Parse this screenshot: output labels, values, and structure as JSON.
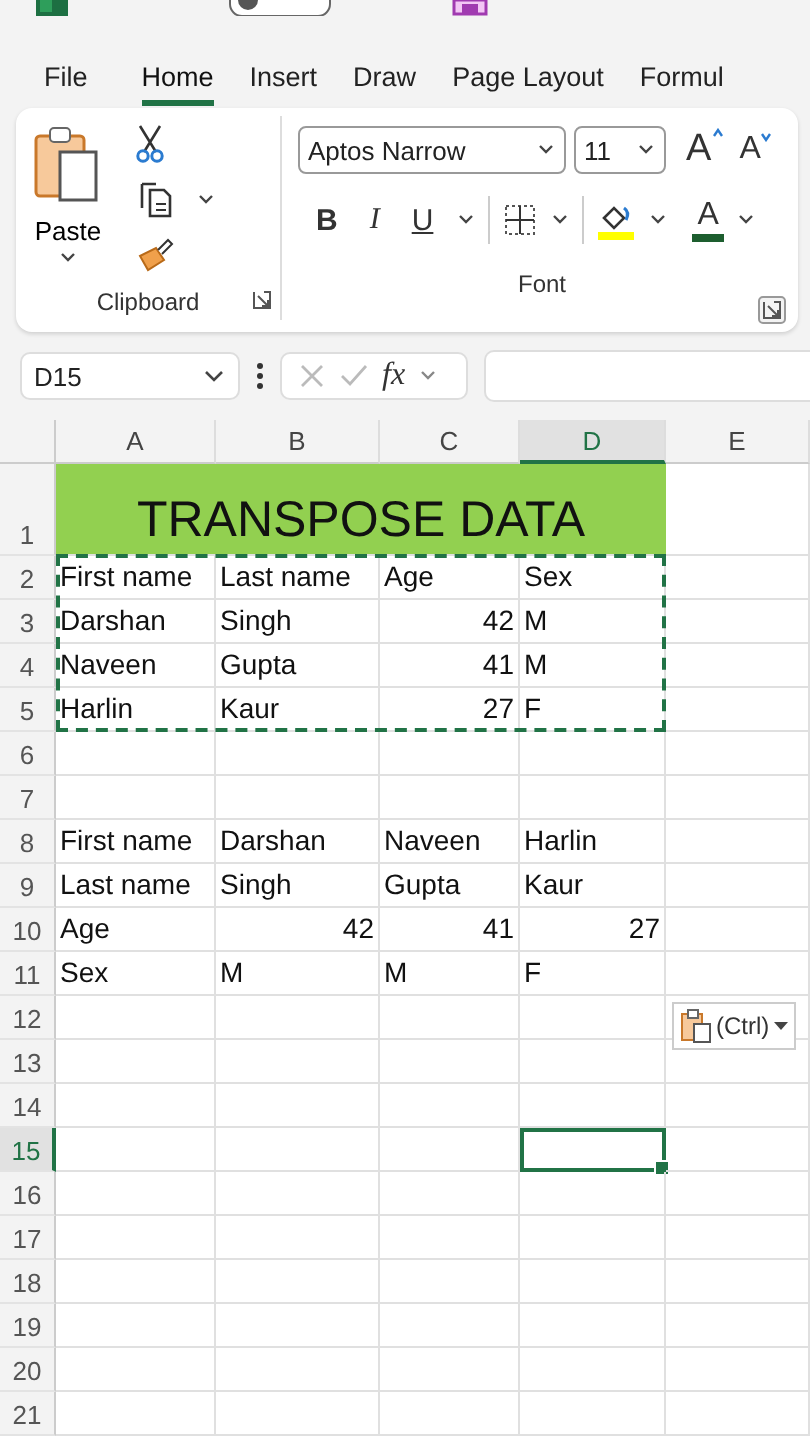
{
  "title_bar": {
    "autosave_on": false
  },
  "tabs": [
    {
      "label": "File",
      "selected": false
    },
    {
      "label": "Home",
      "selected": true
    },
    {
      "label": "Insert",
      "selected": false
    },
    {
      "label": "Draw",
      "selected": false
    },
    {
      "label": "Page Layout",
      "selected": false
    },
    {
      "label": "Formul",
      "selected": false
    }
  ],
  "ribbon": {
    "clipboard": {
      "paste_label": "Paste",
      "group_label": "Clipboard"
    },
    "font": {
      "font_name": "Aptos Narrow",
      "font_size": "11",
      "grow_label": "A",
      "shrink_label": "A",
      "bold": "B",
      "italic": "I",
      "underline": "U",
      "font_color_label": "A",
      "group_label": "Font"
    }
  },
  "formula_bar": {
    "name_box": "D15",
    "fx": "fx"
  },
  "sheet": {
    "columns": [
      {
        "label": "A",
        "selected": false
      },
      {
        "label": "B",
        "selected": false
      },
      {
        "label": "C",
        "selected": false
      },
      {
        "label": "D",
        "selected": true
      },
      {
        "label": "E",
        "selected": false
      }
    ],
    "title_cell": "TRANSPOSE DATA",
    "rows": [
      {
        "number": "1",
        "selected": false,
        "copied": false,
        "kind": "title"
      },
      {
        "number": "2",
        "selected": false,
        "copied": true,
        "kind": "cells",
        "cells": {
          "A": {
            "text": "First name",
            "kind": "text"
          },
          "B": {
            "text": "Last name",
            "kind": "text"
          },
          "C": {
            "text": "Age",
            "kind": "text"
          },
          "D": {
            "text": "Sex",
            "kind": "text"
          }
        }
      },
      {
        "number": "3",
        "selected": false,
        "copied": true,
        "kind": "cells",
        "cells": {
          "A": {
            "text": "Darshan",
            "kind": "text"
          },
          "B": {
            "text": "Singh",
            "kind": "text"
          },
          "C": {
            "text": "42",
            "kind": "number"
          },
          "D": {
            "text": "M",
            "kind": "text"
          }
        }
      },
      {
        "number": "4",
        "selected": false,
        "copied": true,
        "kind": "cells",
        "cells": {
          "A": {
            "text": "Naveen",
            "kind": "text"
          },
          "B": {
            "text": "Gupta",
            "kind": "text"
          },
          "C": {
            "text": "41",
            "kind": "number"
          },
          "D": {
            "text": "M",
            "kind": "text"
          }
        }
      },
      {
        "number": "5",
        "selected": false,
        "copied": true,
        "kind": "cells",
        "cells": {
          "A": {
            "text": "Harlin",
            "kind": "text"
          },
          "B": {
            "text": "Kaur",
            "kind": "text"
          },
          "C": {
            "text": "27",
            "kind": "number"
          },
          "D": {
            "text": "F",
            "kind": "text"
          }
        }
      },
      {
        "number": "6",
        "selected": false,
        "copied": false,
        "kind": "cells"
      },
      {
        "number": "7",
        "selected": false,
        "copied": false,
        "kind": "cells"
      },
      {
        "number": "8",
        "selected": false,
        "copied": false,
        "kind": "cells",
        "cells": {
          "A": {
            "text": "First name",
            "kind": "text"
          },
          "B": {
            "text": "Darshan",
            "kind": "text"
          },
          "C": {
            "text": "Naveen",
            "kind": "text"
          },
          "D": {
            "text": "Harlin",
            "kind": "text"
          }
        }
      },
      {
        "number": "9",
        "selected": false,
        "copied": false,
        "kind": "cells",
        "cells": {
          "A": {
            "text": "Last name",
            "kind": "text"
          },
          "B": {
            "text": "Singh",
            "kind": "text"
          },
          "C": {
            "text": "Gupta",
            "kind": "text"
          },
          "D": {
            "text": "Kaur",
            "kind": "text"
          }
        }
      },
      {
        "number": "10",
        "selected": false,
        "copied": false,
        "kind": "cells",
        "cells": {
          "A": {
            "text": "Age",
            "kind": "text"
          },
          "B": {
            "text": "42",
            "kind": "number"
          },
          "C": {
            "text": "41",
            "kind": "number"
          },
          "D": {
            "text": "27",
            "kind": "number"
          }
        }
      },
      {
        "number": "11",
        "selected": false,
        "copied": false,
        "kind": "cells",
        "cells": {
          "A": {
            "text": "Sex",
            "kind": "text"
          },
          "B": {
            "text": "M",
            "kind": "text"
          },
          "C": {
            "text": "M",
            "kind": "text"
          },
          "D": {
            "text": "F",
            "kind": "text"
          }
        }
      },
      {
        "number": "12",
        "selected": false,
        "copied": false,
        "kind": "cells"
      },
      {
        "number": "13",
        "selected": false,
        "copied": false,
        "kind": "cells"
      },
      {
        "number": "14",
        "selected": false,
        "copied": false,
        "kind": "cells"
      },
      {
        "number": "15",
        "selected": true,
        "copied": false,
        "kind": "cells",
        "cells": {
          "D": {
            "kind": "empty",
            "active": true
          }
        }
      },
      {
        "number": "16",
        "selected": false,
        "copied": false,
        "kind": "cells"
      },
      {
        "number": "17",
        "selected": false,
        "copied": false,
        "kind": "cells"
      },
      {
        "number": "18",
        "selected": false,
        "copied": false,
        "kind": "cells"
      },
      {
        "number": "19",
        "selected": false,
        "copied": false,
        "kind": "cells"
      },
      {
        "number": "20",
        "selected": false,
        "copied": false,
        "kind": "cells"
      },
      {
        "number": "21",
        "selected": false,
        "copied": false,
        "kind": "cells"
      }
    ]
  },
  "paste_options": {
    "label": "(Ctrl)"
  }
}
